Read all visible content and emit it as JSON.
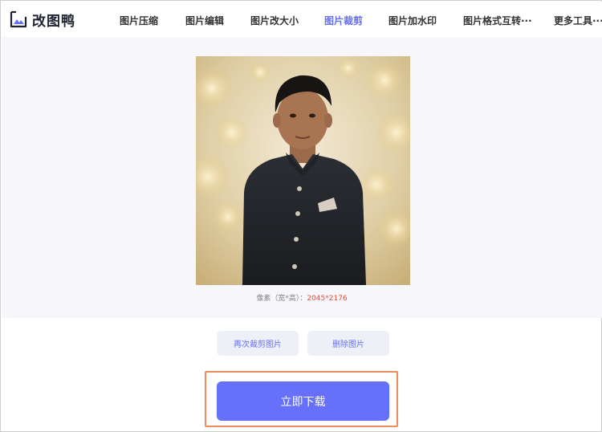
{
  "app": {
    "name": "改图鸭"
  },
  "nav": {
    "items": [
      {
        "label": "图片压缩"
      },
      {
        "label": "图片编辑"
      },
      {
        "label": "图片改大小"
      },
      {
        "label": "图片裁剪"
      },
      {
        "label": "图片加水印"
      },
      {
        "label": "图片格式互转···"
      },
      {
        "label": "更多工具···"
      }
    ],
    "active_index": 3
  },
  "image_info": {
    "label": "像素（宽*高）：",
    "value": "2045*2176"
  },
  "actions": {
    "recrop_label": "再次裁剪图片",
    "delete_label": "删除图片",
    "download_label": "立即下载"
  },
  "colors": {
    "accent": "#6670fa",
    "active_nav": "#6670f2",
    "highlight_border": "#f08a5d",
    "pixel_value": "#e24c3a"
  }
}
